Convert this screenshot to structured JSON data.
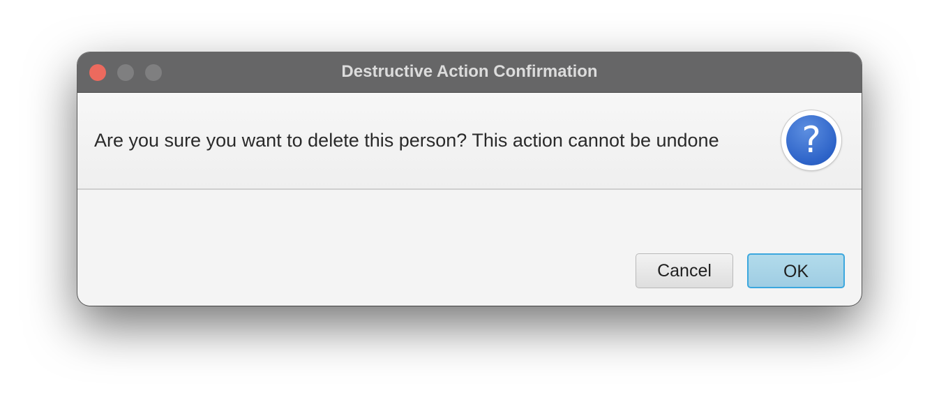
{
  "window": {
    "title": "Destructive Action Confirmation"
  },
  "dialog": {
    "message": "Are you sure you want to delete this person? This action cannot be undone",
    "icon": "question-icon",
    "icon_glyph": "?"
  },
  "buttons": {
    "cancel_label": "Cancel",
    "ok_label": "OK"
  },
  "colors": {
    "titlebar": "#666667",
    "close": "#ec6a5e",
    "accent": "#3ba7de",
    "question_icon": "#2d63c8"
  }
}
